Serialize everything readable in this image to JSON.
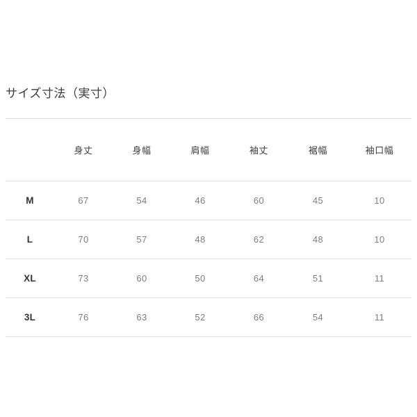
{
  "panel": {
    "title": "サイズ寸法（実寸）",
    "background_color": "#ffffff",
    "rule_color": "#e0e0e0"
  },
  "chart_data": {
    "type": "table",
    "title": "サイズ寸法（実寸）",
    "columns": [
      "",
      "身丈",
      "身幅",
      "肩幅",
      "袖丈",
      "裾幅",
      "袖口幅"
    ],
    "categories": [
      "M",
      "L",
      "XL",
      "3L"
    ],
    "rows": [
      {
        "size": "M",
        "values": [
          "67",
          "54",
          "46",
          "60",
          "45",
          "10"
        ]
      },
      {
        "size": "L",
        "values": [
          "70",
          "57",
          "48",
          "62",
          "48",
          "10"
        ]
      },
      {
        "size": "XL",
        "values": [
          "73",
          "60",
          "50",
          "64",
          "51",
          "11"
        ]
      },
      {
        "size": "3L",
        "values": [
          "76",
          "63",
          "52",
          "66",
          "54",
          "11"
        ]
      }
    ],
    "series": [
      {
        "name": "身丈",
        "values": [
          67,
          70,
          73,
          76
        ]
      },
      {
        "name": "身幅",
        "values": [
          54,
          57,
          60,
          63
        ]
      },
      {
        "name": "肩幅",
        "values": [
          46,
          48,
          50,
          52
        ]
      },
      {
        "name": "袖丈",
        "values": [
          60,
          62,
          64,
          66
        ]
      },
      {
        "name": "裾幅",
        "values": [
          45,
          48,
          51,
          54
        ]
      },
      {
        "name": "袖口幅",
        "values": [
          10,
          10,
          11,
          11
        ]
      }
    ],
    "xlabel": "",
    "ylabel": ""
  }
}
